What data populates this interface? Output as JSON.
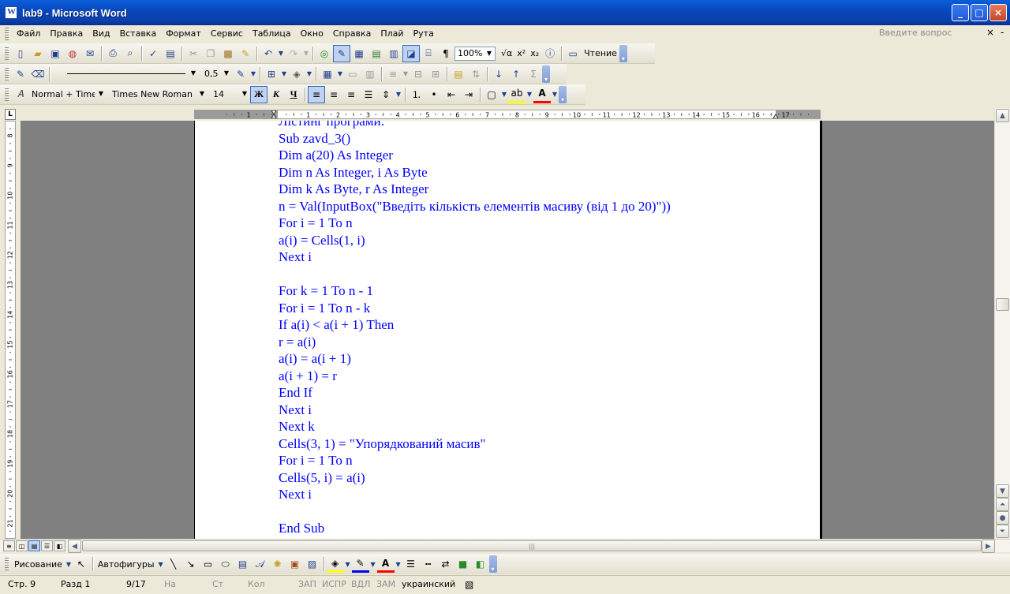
{
  "window": {
    "title": "lab9 - Microsoft Word",
    "buttons": {
      "minimize": "_",
      "maximize": "□",
      "close": "×"
    }
  },
  "menubar": {
    "items": [
      "Файл",
      "Правка",
      "Вид",
      "Вставка",
      "Формат",
      "Сервис",
      "Таблица",
      "Окно",
      "Справка",
      "Плай",
      "Рута"
    ],
    "ask_placeholder": "Введите вопрос",
    "close_glyph": "×",
    "restore_glyph": "-"
  },
  "standard_toolbar": {
    "zoom": "100%",
    "reading_label": "Чтение",
    "sqrt_label": "√α",
    "sup_label": "x²",
    "sub_label": "x₂"
  },
  "tables_toolbar": {
    "line_weight": "0,5"
  },
  "formatting_toolbar": {
    "style": "Normal + Times N",
    "font": "Times New Roman",
    "size": "14",
    "bold": "Ж",
    "italic": "К",
    "underline": "Ч"
  },
  "ruler": {
    "corner": "L",
    "h_ticks": [
      "1",
      "1",
      "2",
      "3",
      "4",
      "5",
      "6",
      "7",
      "8",
      "9",
      "10",
      "11",
      "12",
      "13",
      "14",
      "15",
      "16",
      "17",
      "19"
    ],
    "v_ticks": [
      "8",
      "9",
      "10",
      "11",
      "12",
      "13",
      "14",
      "15",
      "16",
      "17",
      "18",
      "19",
      "20",
      "21"
    ]
  },
  "document": {
    "lines": [
      "Лістинг програми:",
      "Sub zavd_3()",
      "Dim a(20) As Integer",
      "Dim n As Integer, i As Byte",
      "Dim k As Byte, r As Integer",
      "n = Val(InputBox(\"Введіть кількість елементів масиву (від 1 до 20)\"))",
      "For i = 1 To n",
      "a(i) = Cells(1, i)",
      "Next i",
      "",
      "For k = 1 To n - 1",
      "For i = 1 To n - k",
      "If a(i) < a(i + 1) Then",
      "r = a(i)",
      "a(i) = a(i + 1)",
      "a(i + 1) = r",
      "End If",
      "Next i",
      "Next k",
      "Cells(3, 1) = \"Упорядкований масив\"",
      "For i = 1 To n",
      "Cells(5, i) = a(i)",
      "Next i",
      "",
      "End Sub"
    ],
    "text_color": "#0000ff"
  },
  "drawing_toolbar": {
    "draw_label": "Рисование",
    "autoshapes_label": "Автофигуры"
  },
  "statusbar": {
    "page": "Стр. 9",
    "section": "Разд 1",
    "pages": "9/17",
    "at": "На",
    "line": "Ст",
    "col": "Кол",
    "rec": "ЗАП",
    "trk": "ИСПР",
    "ext": "ВДЛ",
    "ovr": "ЗАМ",
    "language": "украинский"
  }
}
